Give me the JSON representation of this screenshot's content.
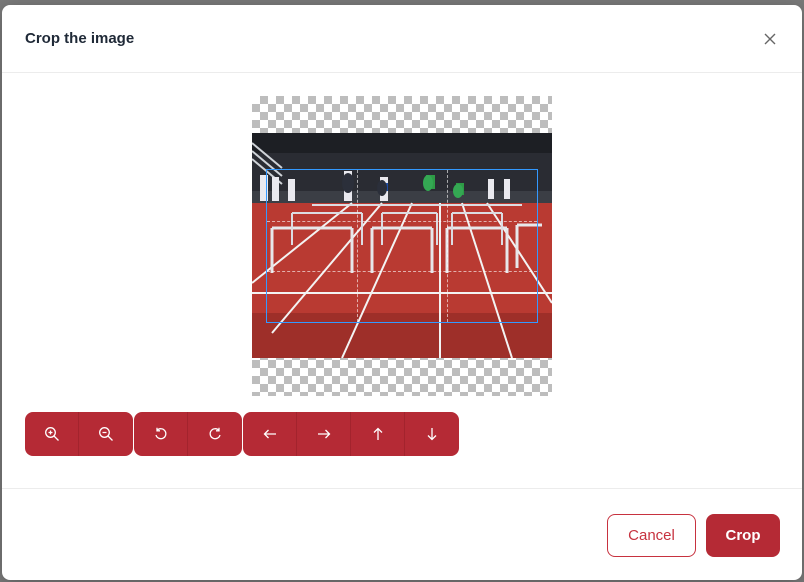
{
  "dialog": {
    "title": "Crop the image",
    "close_icon": "close-icon"
  },
  "image": {
    "subject": "hurdles-on-running-track"
  },
  "toolbar": {
    "groups": [
      [
        "zoom-in-icon",
        "zoom-out-icon"
      ],
      [
        "rotate-left-icon",
        "rotate-right-icon"
      ],
      [
        "arrow-left-icon",
        "arrow-right-icon",
        "arrow-up-icon",
        "arrow-down-icon"
      ]
    ]
  },
  "footer": {
    "cancel_label": "Cancel",
    "crop_label": "Crop"
  },
  "colors": {
    "primary": "#b52a35",
    "cancel_border": "#c7323f",
    "crop_border": "#3399ff"
  }
}
